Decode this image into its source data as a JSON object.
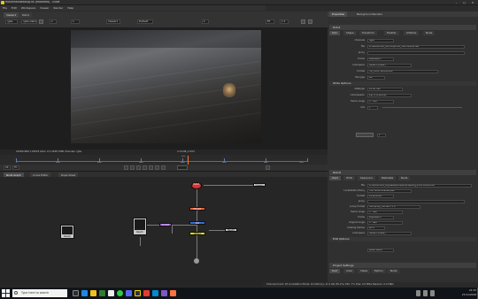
{
  "window": {
    "title": "moveinandeating.nk (modified) - Nuke"
  },
  "menu": [
    "File",
    "Edit",
    "Workspace",
    "Viewer",
    "Render",
    "Help"
  ],
  "viewer": {
    "toolbar": {
      "layer": "rgba",
      "channel": "rgba.alpha",
      "gain": "1",
      "gamma": "1",
      "viewer_node": "Viewer1",
      "frame": "1",
      "zoom": "Fit",
      "proxy": "1:1"
    },
    "tabs": [
      "Viewer1",
      "Roto1"
    ],
    "mode_label": "Default",
    "info_left": "2448x1080 1.25025 bbox: 0 0 2448 1080 channels: rgba",
    "info_mid": "x=2148 y=103"
  },
  "timeline": {
    "ticks": [
      "1",
      "100",
      "200",
      "300",
      "400",
      "500",
      "600",
      "700"
    ],
    "current_frame": "460",
    "fps": "24",
    "playback_mode": "TC"
  },
  "graph": {
    "tabs": [
      "Node Graph",
      "Curve Editor",
      "Dope Sheet"
    ],
    "nodes": {
      "read_a": "Read1",
      "read_b": "Read2",
      "read_c": "Read3",
      "write": "Write1",
      "roto": "Roto1",
      "merge": "Merge1",
      "grade": "Grade1",
      "viewer": "Viewer1",
      "dot": "Dot"
    }
  },
  "properties": {
    "panel_tabs": [
      "Properties",
      "Background Renders"
    ],
    "roto_header": "Roto1",
    "roto_tabs": [
      "Roto",
      "Shape",
      "Transform",
      "Feather",
      "Lifetime",
      "Node"
    ],
    "roto_rows": [
      {
        "label": "channels",
        "value": "rgba"
      },
      {
        "label": "file",
        "value": "D:/NUKE/Shot_01/comp/roto_v003.####.exr"
      },
      {
        "label": "proxy",
        "value": ""
      },
      {
        "label": "frame",
        "value": "expression"
      },
      {
        "label": "colorspace",
        "value": "default (linear)"
      },
      {
        "label": "format",
        "value": "HD_1080 1920x1080"
      },
      {
        "label": "file type",
        "value": "exr"
      },
      {
        "label": "datatype",
        "value": "16 bit half"
      },
      {
        "label": "compression",
        "value": "Zip (1 scanline)"
      },
      {
        "label": "frame range",
        "value": "1 - 100"
      },
      {
        "label": "mix",
        "value": "1"
      }
    ],
    "write_section": "Write Options",
    "render_order": "1",
    "read_header": "Read1",
    "read_tabs": [
      "Read",
      "OCIO",
      "Sequence",
      "Metadata",
      "Node"
    ],
    "read_rows": [
      {
        "label": "file",
        "value": "D:/NUKE/Shot_01/plates/moveinandeating_v001.####.exr"
      },
      {
        "label": "Localization Policy",
        "value": "from auto-localize path"
      },
      {
        "label": "format",
        "value": "2448x1080"
      },
      {
        "label": "proxy",
        "value": ""
      },
      {
        "label": "proxy format",
        "value": "root.proxy_format 1 1 0"
      },
      {
        "label": "frame range",
        "value": "1 - 460"
      },
      {
        "label": "frame",
        "value": "expression"
      },
      {
        "label": "original range",
        "value": "1 - 460"
      },
      {
        "label": "missing frames",
        "value": "error"
      },
      {
        "label": "colorspace",
        "value": "default (linear)"
      }
    ],
    "exr_options": "EXR Options",
    "edge_pixels": "plate detect",
    "project_header": "Project Settings",
    "project_tabs": [
      "Root",
      "Color",
      "Views",
      "Python",
      "Node"
    ]
  },
  "status": "Channel Count: 25  Localization Mode: On  Memory: 11.2 GB (35.2%)  CPU: 7%  Disk: 0.0 MB/s  Network: 0.0 MB/s",
  "taskbar": {
    "search_placeholder": "Type here to search",
    "time": "21:15",
    "date": "27/11/2018"
  },
  "colors": {
    "accent": "#4a6fa8",
    "playhead": "#ff7a2a",
    "read_node": "#c8c8c8",
    "roto_node": "#e03030",
    "write_node": "#e0e000",
    "merge_node": "#3a6ad8",
    "grade_node": "#9a5ad0"
  }
}
